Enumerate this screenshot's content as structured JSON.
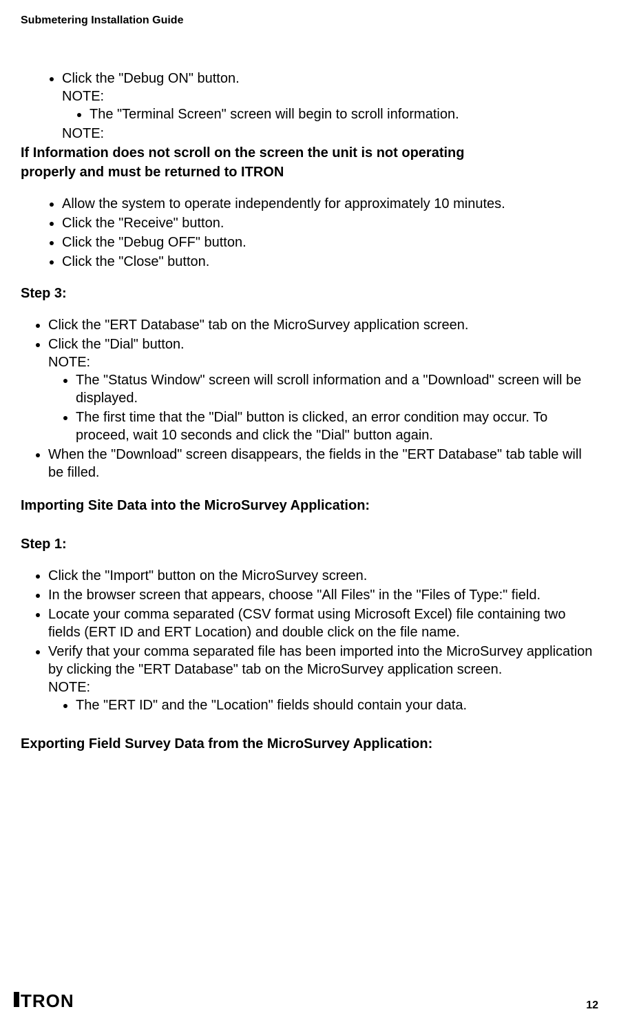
{
  "header": {
    "title": "Submetering Installation Guide"
  },
  "block1": {
    "item1": "Click the \"Debug ON\" button.",
    "note1": "NOTE:",
    "sub1": "The \"Terminal Screen\" screen will begin to scroll information.",
    "note2": "NOTE:"
  },
  "bold_warning_line1": "If Information does not scroll on the screen the unit is not operating",
  "bold_warning_line2": "properly and must be returned to ITRON",
  "block2": {
    "item1": "Allow the system to operate independently for approximately 10 minutes.",
    "item2": "Click the \"Receive\" button.",
    "item3": "Click the \"Debug OFF\" button.",
    "item4": "Click the \"Close\" button."
  },
  "step3_label": "Step 3:",
  "step3": {
    "item1": "Click the \"ERT Database\" tab on the MicroSurvey application screen.",
    "item2": "Click the \"Dial\" button.",
    "note1": "NOTE:",
    "sub1": "The \"Status Window\" screen will scroll information and a \"Download\" screen will be displayed.",
    "sub2": "The first time that the \"Dial\" button is clicked, an error condition may occur. To proceed, wait 10 seconds and click the \"Dial\" button again.",
    "item3": "When the \"Download\" screen disappears, the fields in the \"ERT Database\" tab table will be filled."
  },
  "import_heading": "Importing Site Data into the MicroSurvey Application:",
  "step1_label": "Step 1:",
  "step1": {
    "item1": "Click the \"Import\" button on the MicroSurvey screen.",
    "item2": "In the browser screen that appears, choose \"All Files\" in the \"Files of Type:\" field.",
    "item3": "Locate your comma separated (CSV format using Microsoft Excel) file containing two fields (ERT ID and ERT Location) and double click on the file name.",
    "item4": "Verify that your comma separated file has been imported into the MicroSurvey application by clicking the \"ERT Database\" tab on the MicroSurvey application screen.",
    "note1": "NOTE:",
    "sub1": "The \"ERT ID\" and the \"Location\" fields should contain your data."
  },
  "export_heading": "Exporting Field Survey Data from the MicroSurvey Application:",
  "footer": {
    "logo": "TRON",
    "page": "12"
  }
}
